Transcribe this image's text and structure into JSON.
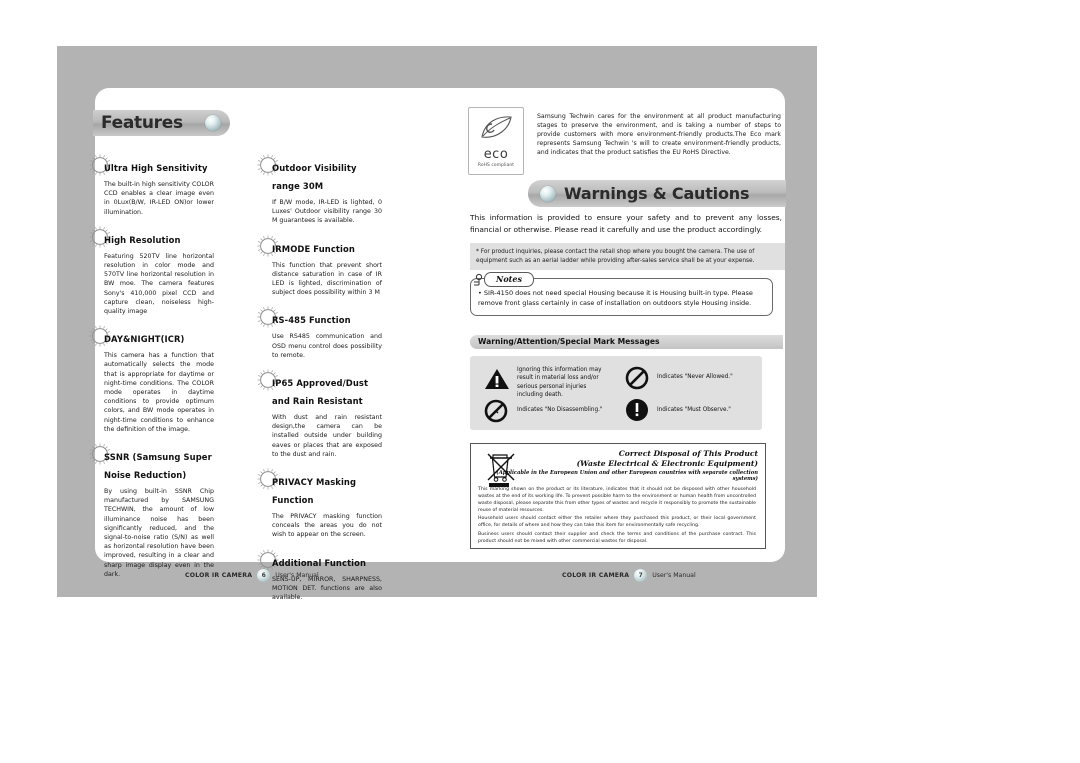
{
  "document": {
    "left_page": {
      "section_title": "Features",
      "footer": {
        "product": "COLOR IR CAMERA",
        "page_number": "6",
        "manual_label": "User's Manual"
      },
      "columns": [
        {
          "features": [
            {
              "heading": "Ultra High Sensitivity",
              "body": "The built-in high sensitivity COLOR CCD enables a clear image even in 0Lux(B/W, IR-LED ON)or lower illumination."
            },
            {
              "heading": "High Resolution",
              "body": "Featuring 520TV line horizontal resolution in color mode and 570TV line horizontal resolution in BW moe. The camera features Sony's 410,000 pixel CCD and capture clean, noiseless high-quality image"
            },
            {
              "heading": "DAY&NIGHT(ICR)",
              "body": "This camera has a function that automatically selects the mode that is appropriate for daytime or night-time conditions.\nThe COLOR mode operates in daytime conditions to provide optimum colors, and BW mode operates in night-time conditions to enhance the definition of the image."
            },
            {
              "heading": "SSNR (Samsung Super Noise Reduction)",
              "body": "By using built-in SSNR Chip manufactured by SAMSUNG TECHWIN, the amount of low illuminance noise has been significantly reduced, and the signal-to-noise ratio (S/N) as well as horizontal resolution have been improved, resulting in a clear and sharp image display even in the dark."
            }
          ]
        },
        {
          "features": [
            {
              "heading": "Outdoor Visibility range 30M",
              "body": "If B/W mode, IR-LED is lighted, 0 Luxes' Outdoor visibility range 30 M guarantees is available."
            },
            {
              "heading": "IRMODE Function",
              "body": "This function that prevent short distance saturation in case of IR LED is lighted, discrimination of subject does possibility within 3 M"
            },
            {
              "heading": "RS-485 Function",
              "body": "Use RS485 communication and OSD menu control does possibility to remote."
            },
            {
              "heading": "IP65 Approved/Dust and Rain Resistant",
              "body": "With dust and rain resistant design,the camera can be installed outside under building eaves or places that\nare exposed to the dust and rain."
            },
            {
              "heading": "PRIVACY  Masking Function",
              "body": "The PRIVACY masking function conceals the areas you do not wish to appear on the screen."
            },
            {
              "heading": "Additional Function",
              "body": "SENS-UP, MIRROR, SHARPNESS, MOTION DET. functions are also available."
            }
          ]
        }
      ]
    },
    "right_page": {
      "section_title": "Warnings & Cautions",
      "eco_mark": {
        "word": "eco",
        "subtitle": "RoHS compliant",
        "icon": "eco-leaf-icon"
      },
      "eco_text": "Samsung Techwin cares for the environment at all product manufacturing stages to preserve the environment, and is taking a number of steps to provide customers with more environment-friendly products.The Eco mark represents Samsung Techwin 's will to create environment-friendly products, and indicates that the product satisfies the EU RoHS Directive.",
      "warning_intro": "This information is provided to ensure your safety and to prevent any losses, financial or otherwise. Please read it carefully and use the product accordingly.",
      "warning_note": "* For product inquiries, please contact the retail shop where you bought the camera. The use of equipment such as an aerial ladder while providing after-sales service shall be at your expense.",
      "notes": {
        "label": "Notes",
        "text": "• SIR-4150 does not need special Housing because it is Housing built-in type. Please remove front glass certainly in case of installation on outdoors style Housing inside."
      },
      "mark_messages": {
        "heading": "Warning/Attention/Special Mark Messages",
        "items": [
          {
            "icon": "warning-triangle-icon",
            "text": "Ignoring this information may result in material loss and/or serious personal injuries including death."
          },
          {
            "icon": "prohibition-circle-icon",
            "text": "Indicates \"Never Allowed.\""
          },
          {
            "icon": "no-disassemble-icon",
            "text": "Indicates \"No Disassembling.\""
          },
          {
            "icon": "exclamation-circle-icon",
            "text": "Indicates  \"Must Observe.\""
          }
        ]
      },
      "disposal": {
        "icon": "crossed-out-wheelie-bin-icon",
        "title": "Correct Disposal of This Product",
        "title2": "(Waste Electrical & Electronic Equipment)",
        "subtitle": "(Applicable in the European Union and other European countries with separate collection systems)",
        "paragraphs": [
          "This marking shown on the product or its literature, indicates that it should not be disposed with other household wastes at the end of its working life. To prevent possible harm to the environment or human health from uncontrolled waste disposal, please separate this from other types of wastes and recycle it responsibly to promote the sustainable reuse of material resources.",
          "Household users should contact either the retailer where they purchased this product, or their local government office, for details of where and how they can take this item for environmentally safe recycling.",
          "Business users should contact their supplier and check the terms and conditions of the purchase contract.\nThis product should not be mixed with other commercial wastes for disposal."
        ]
      },
      "footer": {
        "product": "COLOR IR CAMERA",
        "page_number": "7",
        "manual_label": "User's Manual"
      }
    }
  },
  "colors": {
    "frame_gray": "#b3b3b3",
    "panel_gray": "#e0e0e0",
    "page_white": "#ffffff",
    "text_dark": "#111111"
  }
}
